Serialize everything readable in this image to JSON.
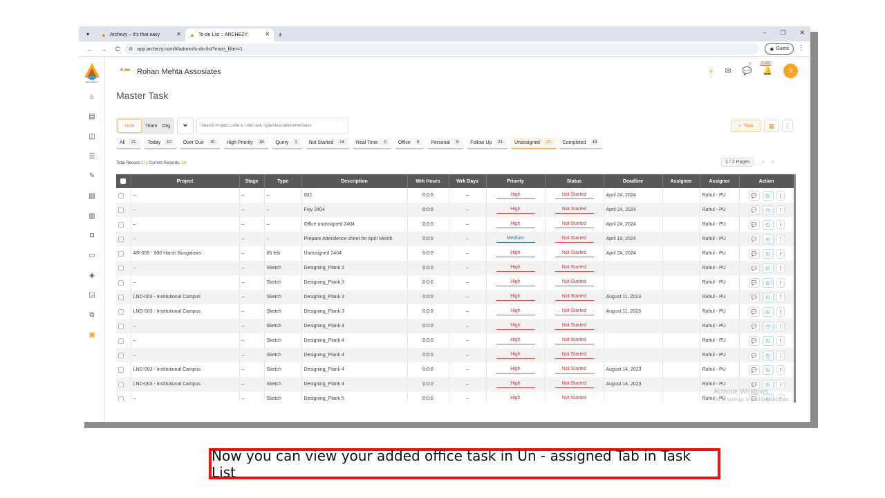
{
  "browser": {
    "tabs": [
      {
        "title": "Archezy – It's that easy"
      },
      {
        "title": "To-do List :: ARCHEZY"
      }
    ],
    "url": "app.archezy.com/#/admin/to-do-list?main_filter=1",
    "profile_label": "Guest"
  },
  "sidebar": {
    "logo_text": "ARCHEZY"
  },
  "header": {
    "firm_name": "Rohan Mehta Assosiates",
    "notif_count": "0",
    "credits": "2080",
    "avatar_letter": "R"
  },
  "page": {
    "title": "Master Task"
  },
  "toolbar": {
    "scope_options": [
      "User",
      "Team",
      "Org."
    ],
    "search_placeholder": "Search Project Code & Title/Task Type/Description/Remarks",
    "add_task_label": "Task"
  },
  "filters": [
    {
      "label": "All",
      "count": "21"
    },
    {
      "label": "Today",
      "count": "10"
    },
    {
      "label": "Over Due",
      "count": "10"
    },
    {
      "label": "High Priority",
      "count": "18"
    },
    {
      "label": "Query",
      "count": "1"
    },
    {
      "label": "Not Started",
      "count": "14"
    },
    {
      "label": "Real Time",
      "count": "0"
    },
    {
      "label": "Office",
      "count": "8"
    },
    {
      "label": "Personal",
      "count": "5"
    },
    {
      "label": "Follow Up",
      "count": "21"
    },
    {
      "label": "Unassigned",
      "count": "23",
      "active": true
    },
    {
      "label": "Completed",
      "count": "19"
    }
  ],
  "records": {
    "total_label": "Total Record:",
    "total": "23",
    "sep": " | ",
    "current_label": "Current Records: ",
    "current": "20"
  },
  "pagination": {
    "label": "1 / 2 Pages"
  },
  "table": {
    "columns": [
      "Project",
      "Stage",
      "Type",
      "Description",
      "Wrk Hours",
      "Wrk Days",
      "Priority",
      "Status",
      "Deadline",
      "Assignee",
      "Assignor",
      "Action"
    ],
    "rows": [
      {
        "project": "–",
        "stage": "–",
        "type": "–",
        "description": "002",
        "wrk_hours": "0:0:0",
        "wrk_days": "–",
        "priority": "High",
        "status": "Not Started",
        "deadline": "April 24, 2024",
        "assignee": "",
        "assignor": "Rahul - PU"
      },
      {
        "project": "–",
        "stage": "–",
        "type": "–",
        "description": "Fvjv 2404",
        "wrk_hours": "0:0:0",
        "wrk_days": "–",
        "priority": "High",
        "status": "Not Started",
        "deadline": "April 24, 2024",
        "assignee": "",
        "assignor": "Rahul - PU"
      },
      {
        "project": "–",
        "stage": "–",
        "type": "–",
        "description": "Office unassigned 2404",
        "wrk_hours": "0:0:0",
        "wrk_days": "–",
        "priority": "High",
        "status": "Not Started",
        "deadline": "April 24, 2024",
        "assignee": "",
        "assignor": "Rahul - PU"
      },
      {
        "project": "–",
        "stage": "–",
        "type": "–",
        "description": "Prepare Attendence sheet for April Month",
        "wrk_hours": "0:0:0",
        "wrk_days": "–",
        "priority": "Medium",
        "status": "Not Started",
        "deadline": "April 19, 2024",
        "assignee": "",
        "assignor": "Rahul - PU"
      },
      {
        "project": "AR-005 - 900 Harsh Bungalows",
        "stage": "–",
        "type": "05 feb",
        "description": "Unassigned 2404",
        "wrk_hours": "0:0:0",
        "wrk_days": "–",
        "priority": "High",
        "status": "Not Started",
        "deadline": "April 24, 2024",
        "assignee": "",
        "assignor": "Rahul - PU"
      },
      {
        "project": "–",
        "stage": "–",
        "type": "Sketch",
        "description": "Designing_Plank 3",
        "wrk_hours": "0:0:0",
        "wrk_days": "–",
        "priority": "High",
        "status": "Not Started",
        "deadline": "",
        "assignee": "",
        "assignor": "Rahul - PU"
      },
      {
        "project": "–",
        "stage": "–",
        "type": "Sketch",
        "description": "Designing_Plank 3",
        "wrk_hours": "0:0:0",
        "wrk_days": "–",
        "priority": "High",
        "status": "Not Started",
        "deadline": "",
        "assignee": "",
        "assignor": "Rahul - PU"
      },
      {
        "project": "LND-003 - Institutional Campus",
        "stage": "–",
        "type": "Sketch",
        "description": "Designing_Plank 3",
        "wrk_hours": "0:0:0",
        "wrk_days": "–",
        "priority": "High",
        "status": "Not Started",
        "deadline": "August 11, 2023",
        "assignee": "",
        "assignor": "Rahul - PU"
      },
      {
        "project": "LND-003 - Institutional Campus",
        "stage": "–",
        "type": "Sketch",
        "description": "Designing_Plank 3",
        "wrk_hours": "0:0:0",
        "wrk_days": "–",
        "priority": "High",
        "status": "Not Started",
        "deadline": "August 11, 2023",
        "assignee": "",
        "assignor": "Rahul - PU"
      },
      {
        "project": "–",
        "stage": "–",
        "type": "Sketch",
        "description": "Designing_Plank 4",
        "wrk_hours": "0:0:0",
        "wrk_days": "–",
        "priority": "High",
        "status": "Not Started",
        "deadline": "",
        "assignee": "",
        "assignor": "Rahul - PU"
      },
      {
        "project": "–",
        "stage": "–",
        "type": "Sketch",
        "description": "Designing_Plank 4",
        "wrk_hours": "0:0:0",
        "wrk_days": "–",
        "priority": "High",
        "status": "Not Started",
        "deadline": "",
        "assignee": "",
        "assignor": "Rahul - PU"
      },
      {
        "project": "–",
        "stage": "–",
        "type": "Sketch",
        "description": "Designing_Plank 4",
        "wrk_hours": "0:0:0",
        "wrk_days": "–",
        "priority": "High",
        "status": "Not Started",
        "deadline": "",
        "assignee": "",
        "assignor": "Rahul - PU"
      },
      {
        "project": "LND-003 - Institutional Campus",
        "stage": "–",
        "type": "Sketch",
        "description": "Designing_Plank 4",
        "wrk_hours": "0:0:0",
        "wrk_days": "–",
        "priority": "High",
        "status": "Not Started",
        "deadline": "August 14, 2023",
        "assignee": "",
        "assignor": "Rahul - PU"
      },
      {
        "project": "LND-003 - Institutional Campus",
        "stage": "–",
        "type": "Sketch",
        "description": "Designing_Plank 4",
        "wrk_hours": "0:0:0",
        "wrk_days": "–",
        "priority": "High",
        "status": "Not Started",
        "deadline": "August 14, 2023",
        "assignee": "",
        "assignor": "Rahul - PU"
      },
      {
        "project": "–",
        "stage": "–",
        "type": "Sketch",
        "description": "Designing_Plank 5",
        "wrk_hours": "0:0:0",
        "wrk_days": "–",
        "priority": "High",
        "status": "Not Started",
        "deadline": "",
        "assignee": "",
        "assignor": "Rahul - PU"
      }
    ]
  },
  "watermark": {
    "line1": "Activate Windows",
    "line2": "Go to Settings to activate Windows."
  },
  "caption": "Now you can view your added office task in Un - assigned Tab in Task List",
  "colors": {
    "accent": "#e88b2a",
    "danger": "#d9302f",
    "medium": "#2c6fbf",
    "header": "#595959",
    "caption_border": "#ee1111"
  }
}
